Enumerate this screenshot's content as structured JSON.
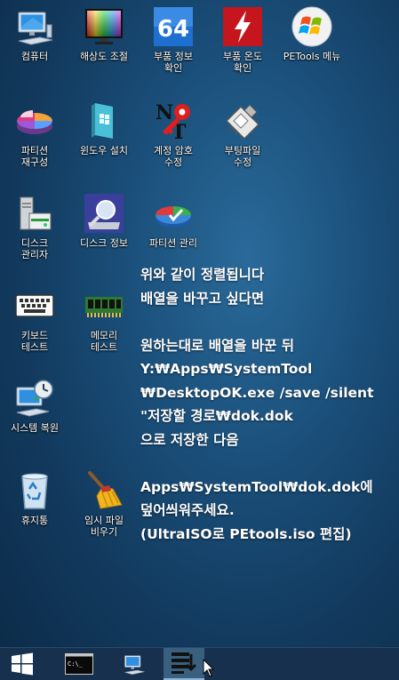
{
  "desktop": {
    "icons": [
      {
        "label": "컴퓨터",
        "icon": "computer-icon"
      },
      {
        "label": "해상도 조절",
        "icon": "display-resolution-icon"
      },
      {
        "label": "부품 정보\n확인",
        "icon": "cpu-z-64-icon"
      },
      {
        "label": "부품 온도\n확인",
        "icon": "hwmonitor-icon"
      },
      {
        "label": "PETools 메뉴",
        "icon": "windows-logo-icon"
      },
      {
        "label": "파티션\n재구성",
        "icon": "partition-pie-icon"
      },
      {
        "label": "윈도우 설치",
        "icon": "windows-install-icon"
      },
      {
        "label": "계정 암호\n수정",
        "icon": "ntpwedit-key-icon"
      },
      {
        "label": "부팅파일\n수정",
        "icon": "boot-file-edit-icon"
      },
      {
        "label": "디스크\n관리자",
        "icon": "disk-manager-icon"
      },
      {
        "label": "디스크 정보",
        "icon": "disk-info-icon"
      },
      {
        "label": "파티션 관리",
        "icon": "partition-manager-icon"
      },
      {
        "label": "키보드\n테스트",
        "icon": "keyboard-icon"
      },
      {
        "label": "메모리\n테스트",
        "icon": "memory-ram-icon"
      },
      {
        "label": "시스템 복원",
        "icon": "system-restore-icon"
      },
      {
        "label": "휴지통",
        "icon": "recycle-bin-icon"
      },
      {
        "label": "임시 파일\n비우기",
        "icon": "broom-cleanup-icon"
      }
    ]
  },
  "note": {
    "lines": [
      "위와 같이 정렬됩니다",
      "배열을 바꾸고 싶다면",
      "",
      "원하는대로 배열을 바꾼 뒤",
      "Y:₩Apps₩SystemTool",
      "₩DesktopOK.exe /save /silent",
      "\"저장할 경로₩dok.dok",
      "으로 저장한 다음",
      "",
      "Apps₩SystemTool₩dok.dok에",
      "덮어씌워주세요.",
      "(UltraISO로 PEtools.iso 편집)"
    ]
  },
  "taskbar": {
    "items": [
      {
        "icon": "start-windows-icon"
      },
      {
        "icon": "command-prompt-icon",
        "text": "C:\\_"
      },
      {
        "icon": "computer-icon"
      },
      {
        "icon": "desktopok-icon",
        "active": true
      }
    ]
  },
  "colors": {
    "text": "#ffffff",
    "taskbar": "#16304d",
    "active": "#3a607f"
  }
}
